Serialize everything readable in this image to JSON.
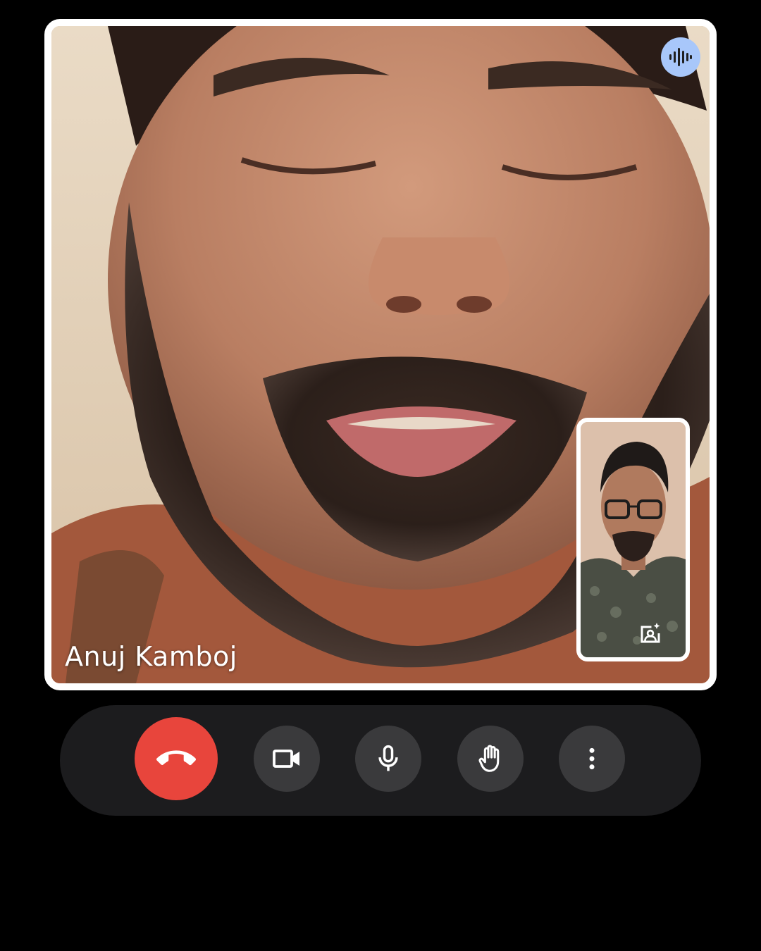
{
  "call": {
    "remote_participant": {
      "name": "Anuj Kamboj",
      "speaking_indicator_icon": "audio-waveform-icon"
    },
    "self_view": {
      "effects_icon": "image-sparkle-icon"
    }
  },
  "controls": [
    {
      "id": "end-call",
      "icon": "phone-hangup-icon",
      "color": "#e8453c"
    },
    {
      "id": "camera",
      "icon": "videocam-icon"
    },
    {
      "id": "microphone",
      "icon": "mic-icon"
    },
    {
      "id": "raise-hand",
      "icon": "hand-icon"
    },
    {
      "id": "more-options",
      "icon": "more-vertical-icon"
    }
  ],
  "colors": {
    "background": "#000000",
    "control_bar": "#1c1c1e",
    "control_button": "#3a3a3c",
    "end_call": "#e8453c",
    "speaking_indicator": "#a8c7fa",
    "tile_border": "#ffffff"
  }
}
